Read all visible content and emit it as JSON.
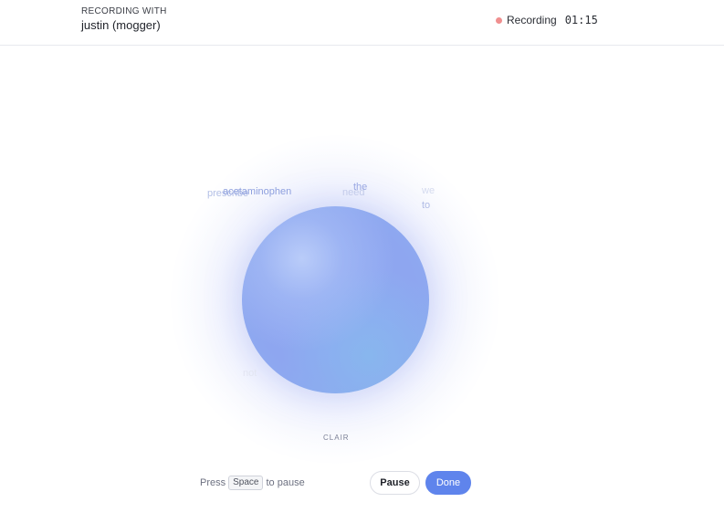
{
  "header": {
    "recording_with_label": "RECORDING WITH",
    "participant": "justin (mogger)",
    "status_label": "Recording",
    "timer": "01:15",
    "status_color": "#f08f8f"
  },
  "visualizer": {
    "words": {
      "prescribe": "prescribe",
      "acetaminophen": "acetaminophen",
      "need": "need",
      "the": "the",
      "we": "we",
      "to": "to",
      "not": "not"
    },
    "speaker": "CLAIR",
    "orb_color": "#8fa8f2"
  },
  "footer": {
    "hint_prefix": "Press",
    "hint_key": "Space",
    "hint_suffix": "to pause",
    "pause_label": "Pause",
    "done_label": "Done",
    "accent": "#5f84ec"
  }
}
